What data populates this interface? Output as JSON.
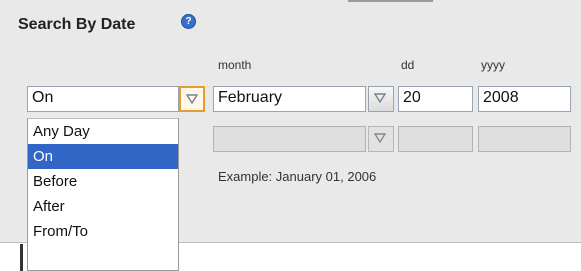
{
  "section": {
    "title": "Search By Date",
    "help_icon": "?"
  },
  "headers": {
    "month": "month",
    "day": "dd",
    "year": "yyyy"
  },
  "mode_select": {
    "value": "On",
    "options": [
      "Any Day",
      "On",
      "Before",
      "After",
      "From/To"
    ],
    "selected_index": 1
  },
  "date1": {
    "month": "February",
    "day": "20",
    "year": "2008"
  },
  "date2": {
    "month": "",
    "day": "",
    "year": ""
  },
  "example_text": "Example: January 01, 2006",
  "colors": {
    "selection": "#3166c7",
    "focus_border": "#e89a2b"
  }
}
